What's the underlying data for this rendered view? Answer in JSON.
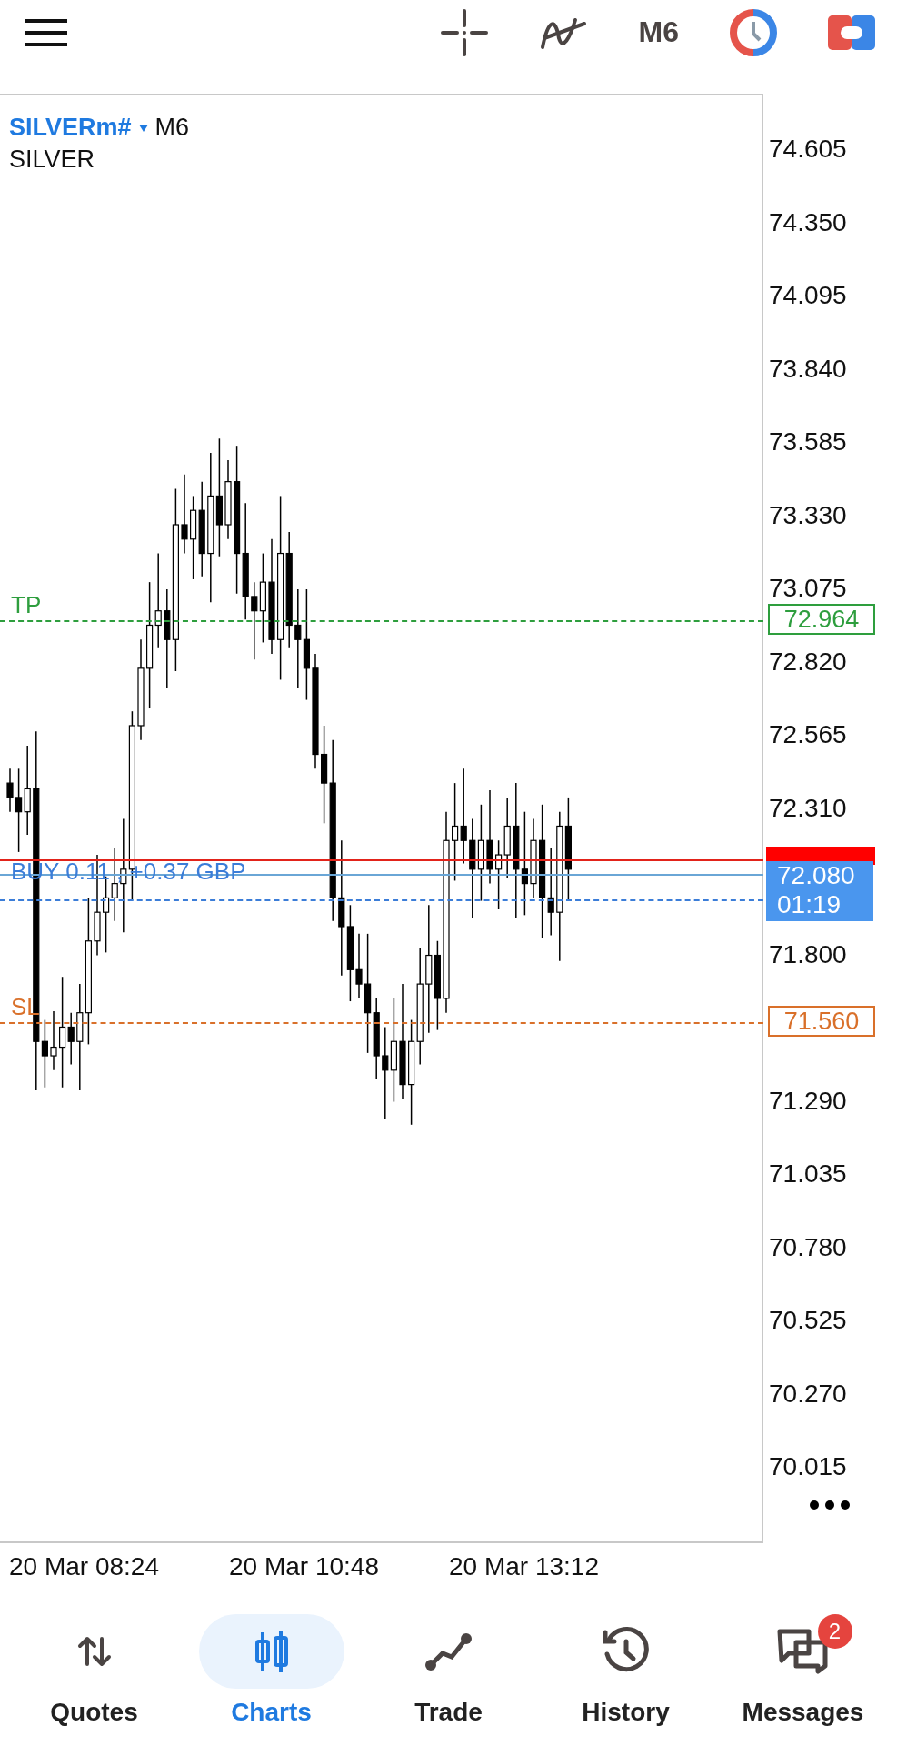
{
  "toolbar": {
    "timeframe": "M6"
  },
  "chart": {
    "symbol": "SILVERm#",
    "timeframe": "M6",
    "description": "SILVER",
    "price_axis": [
      "74.605",
      "74.350",
      "74.095",
      "73.840",
      "73.585",
      "73.330",
      "73.075",
      "72.820",
      "72.565",
      "72.310",
      "71.800",
      "71.290",
      "71.035",
      "70.780",
      "70.525",
      "70.270",
      "70.015"
    ],
    "time_axis": [
      "20 Mar 08:24",
      "20 Mar 10:48",
      "20 Mar 13:12"
    ],
    "levels": [
      {
        "kind": "tp",
        "label": "TP",
        "tag": "72.964",
        "color": "#2e9e3e"
      },
      {
        "kind": "sl",
        "label": "SL",
        "tag": "71.560",
        "color": "#d9702a"
      }
    ],
    "position": {
      "label": "BUY 0.11 ,  +0.37 GBP"
    },
    "bid": {
      "price": "72.080",
      "countdown": "01:19"
    }
  },
  "nav": [
    {
      "kind": "quotes",
      "label": "Quotes",
      "selected": false
    },
    {
      "kind": "charts",
      "label": "Charts",
      "selected": true
    },
    {
      "kind": "trade",
      "label": "Trade",
      "selected": false
    },
    {
      "kind": "history",
      "label": "History",
      "selected": false
    },
    {
      "kind": "messages",
      "label": "Messages",
      "selected": false,
      "badge": "2"
    }
  ]
}
